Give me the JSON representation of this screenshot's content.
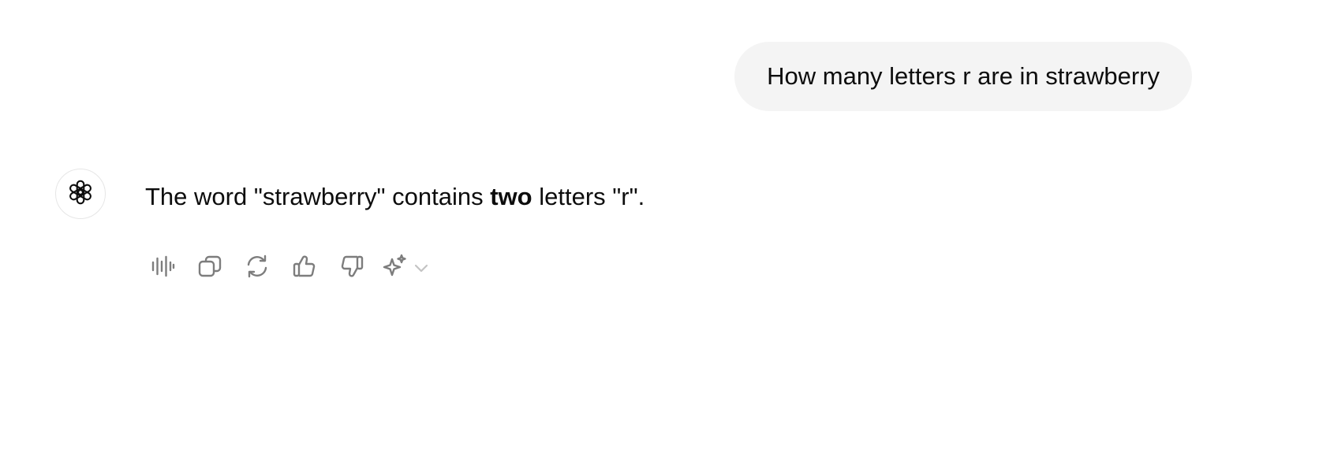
{
  "user_message": {
    "text": "How many letters r are in strawberry"
  },
  "assistant_message": {
    "before": "The word \"strawberry\" contains ",
    "bold": "two",
    "after": " letters \"r\"."
  },
  "avatar_icon": "openai-logo-icon",
  "action_icons": [
    "read-aloud-icon",
    "copy-icon",
    "regenerate-icon",
    "thumbs-up-icon",
    "thumbs-down-icon",
    "sparkle-icon",
    "chevron-down-icon"
  ],
  "colors": {
    "bubble_bg": "#f4f4f4",
    "text": "#0d0d0d",
    "icon": "#7d7d7d",
    "chevron": "#c4c4c4",
    "avatar_border": "#e6e6e6"
  }
}
